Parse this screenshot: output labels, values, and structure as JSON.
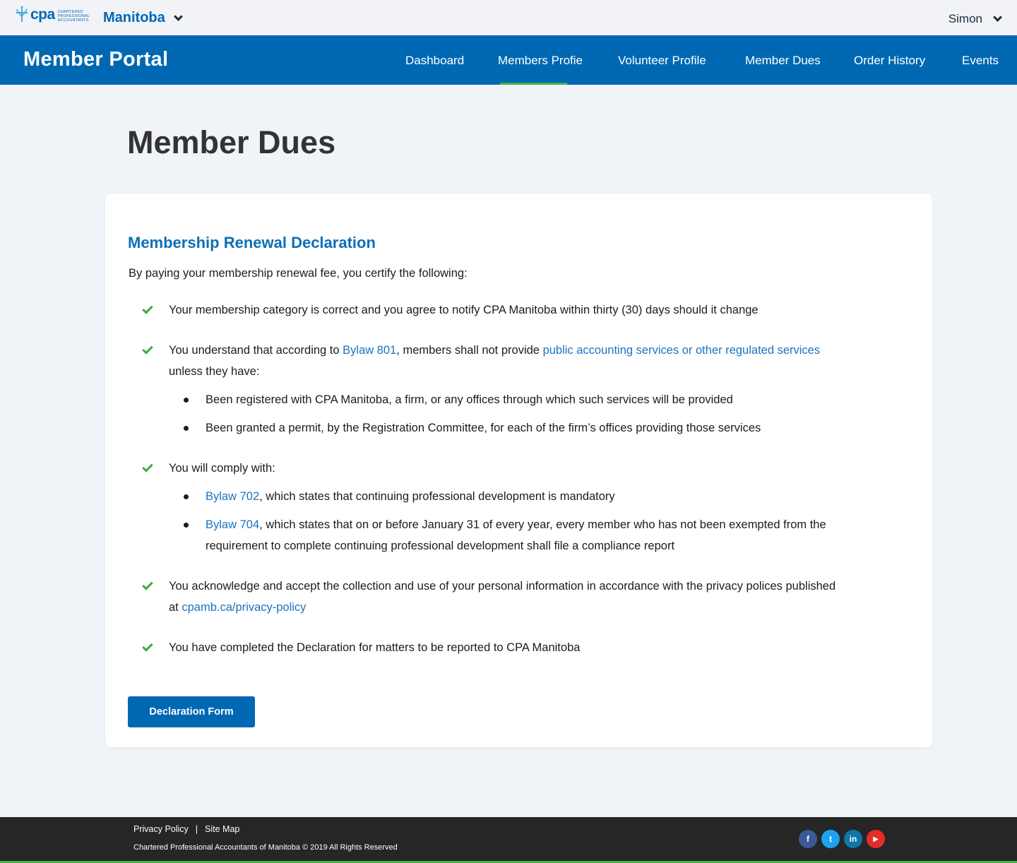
{
  "header": {
    "logo_word": "cpa",
    "logo_sub": [
      "Chartered",
      "Professional",
      "Accountants"
    ],
    "region": "Manitoba",
    "user": "Simon"
  },
  "nav": {
    "portal_title": "Member Portal",
    "items": [
      "Dashboard",
      "Members Profie",
      "Volunteer Profile",
      "Member Dues",
      "Order History",
      "Events"
    ],
    "active": "Members Profie"
  },
  "page": {
    "title": "Member Dues"
  },
  "card": {
    "title": "Membership Renewal Declaration",
    "intro": "By paying your membership renewal fee, you certify the following:",
    "item1": "Your membership category is correct and you agree to notify CPA Manitoba within thirty (30) days should it change",
    "item2": {
      "pre": "You understand that according to ",
      "link1": "Bylaw 801",
      "mid": ", members shall not provide ",
      "link2": "public accounting services or other regulated services",
      "line2": "unless they have:",
      "bullets": [
        "Been registered with CPA Manitoba, a firm, or any offices through which such services will be provided",
        "Been granted a permit, by the Registration Committee, for each of the firm’s offices providing those services"
      ]
    },
    "item3": {
      "text": "You will comply with:",
      "b1_link": "Bylaw 702",
      "b1_text": ", which states that continuing professional development is mandatory",
      "b2_link": "Bylaw 704",
      "b2_text": ", which states that on or before January 31 of every year, every member who has not been exempted from the",
      "b2_line2": "requirement to complete continuing professional development shall file a compliance report"
    },
    "item4": {
      "line1": "You acknowledge and accept the collection and use of your personal information in accordance with the privacy polices published",
      "pre2": "at ",
      "link": "cpamb.ca/privacy-policy"
    },
    "item5": "You have completed the Declaration for matters to be reported to CPA Manitoba",
    "button": "Declaration Form"
  },
  "footer": {
    "privacy": "Privacy Policy",
    "separator": "|",
    "sitemap": "Site Map",
    "copyright": "Chartered Professional Accountants of Manitoba © 2019 All Rights Reserved",
    "social": [
      {
        "name": "facebook-icon",
        "glyph": "f",
        "color": "#3b5998"
      },
      {
        "name": "twitter-icon",
        "glyph": "t",
        "color": "#1da1f2"
      },
      {
        "name": "linkedin-icon",
        "glyph": "in",
        "color": "#0e76a8"
      },
      {
        "name": "youtube-icon",
        "glyph": "▶",
        "color": "#e52d27"
      }
    ]
  },
  "colors": {
    "brand_blue": "#0068b3",
    "accent_green": "#3fb549",
    "link_blue": "#1a73c2",
    "check_green": "#3aae3a"
  }
}
